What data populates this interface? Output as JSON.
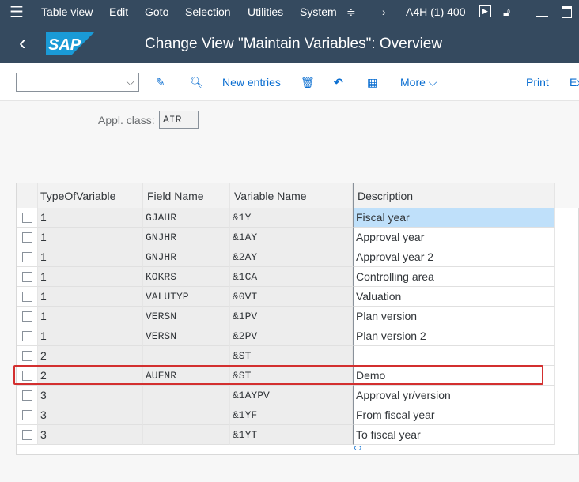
{
  "menu": {
    "items": [
      "Table view",
      "Edit",
      "Goto",
      "Selection",
      "Utilities",
      "System"
    ],
    "system_info": "A4H (1) 400"
  },
  "header": {
    "title": "Change View \"Maintain Variables\": Overview",
    "logo": "SAP"
  },
  "toolbar": {
    "new_entries": "New entries",
    "more": "More",
    "print": "Print",
    "export": "Ex"
  },
  "form": {
    "appl_class_label": "Appl. class:",
    "appl_class_value": "AIR"
  },
  "table": {
    "columns": [
      "TypeOfVariable",
      "Field Name",
      "Variable Name",
      "Description"
    ],
    "rows": [
      [
        "1",
        "GJAHR",
        "&1Y",
        "Fiscal year"
      ],
      [
        "1",
        "GNJHR",
        "&1AY",
        "Approval year"
      ],
      [
        "1",
        "GNJHR",
        "&2AY",
        "Approval year 2"
      ],
      [
        "1",
        "KOKRS",
        "&1CA",
        "Controlling area"
      ],
      [
        "1",
        "VALUTYP",
        "&0VT",
        "Valuation"
      ],
      [
        "1",
        "VERSN",
        "&1PV",
        "Plan version"
      ],
      [
        "1",
        "VERSN",
        "&2PV",
        "Plan version 2"
      ],
      [
        "2",
        "",
        "&ST",
        ""
      ],
      [
        "2",
        "AUFNR",
        "&ST",
        "Demo"
      ],
      [
        "3",
        "",
        "&1AYPV",
        "Approval yr/version"
      ],
      [
        "3",
        "",
        "&1YF",
        "From fiscal year"
      ],
      [
        "3",
        "",
        "&1YT",
        "To fiscal year"
      ]
    ],
    "scroll": "‹ ›"
  },
  "colors": {
    "shell": "#354a5f",
    "link": "#0a6ed1",
    "highlight": "#d32f2f",
    "selected_cell": "#bfe0fa"
  }
}
